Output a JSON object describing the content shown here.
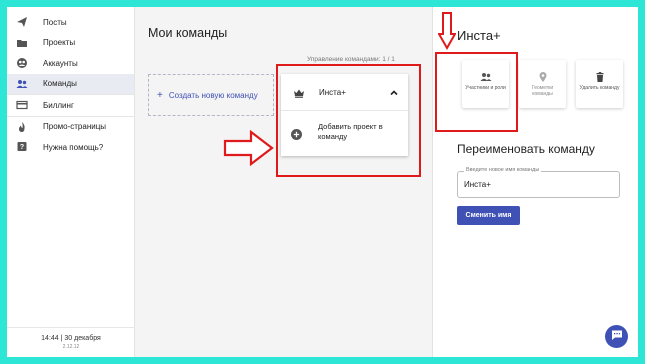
{
  "sidebar": {
    "items": [
      {
        "label": "Посты",
        "icon": "send-icon"
      },
      {
        "label": "Проекты",
        "icon": "folder-icon"
      },
      {
        "label": "Аккаунты",
        "icon": "account-circle-icon"
      },
      {
        "label": "Команды",
        "icon": "people-icon"
      },
      {
        "label": "Биллинг",
        "icon": "credit-card-icon"
      },
      {
        "label": "Промо-страницы",
        "icon": "flame-icon"
      },
      {
        "label": "Нужна помощь?",
        "icon": "help-icon"
      }
    ],
    "active_index": 3,
    "footer": {
      "time": "14:44 | 30 декабря",
      "version": "2.12.12"
    }
  },
  "main": {
    "title": "Мои команды",
    "manage_label": "Управление командами: 1 / 1",
    "create_label": "Создать новую команду",
    "team": {
      "name": "Инста+",
      "add_project": "Добавить проект в команду"
    }
  },
  "right": {
    "title": "Инста+",
    "buttons": [
      {
        "label": "Участники и роли",
        "icon": "people-icon"
      },
      {
        "label": "Геометки команды",
        "icon": "location-pin-icon"
      },
      {
        "label": "Удалить команду",
        "icon": "trash-icon"
      }
    ],
    "rename_title": "Переименовать команду",
    "field_label": "Введите новое имя команды",
    "field_value": "Инста+",
    "submit_label": "Сменить имя"
  },
  "colors": {
    "accent": "#3f51b5",
    "highlight": "#e01a1a",
    "background": "#2ee6d6"
  }
}
